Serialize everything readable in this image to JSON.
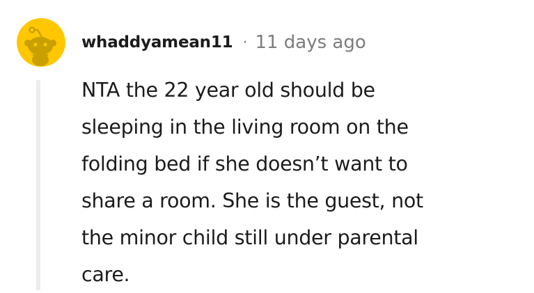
{
  "comment": {
    "author": "whaddyamean11",
    "separator": "·",
    "timestamp": "11 days ago",
    "body": "NTA the 22 year old should be\nsleeping in the living room on the\nfolding bed if she doesn’t want to\nshare a room. She is the guest, not\nthe minor child still under parental\ncare.",
    "avatar": {
      "icon": "snoo-avatar-icon",
      "background_color": "#FFC700",
      "figure_color": "#C9A000"
    }
  }
}
